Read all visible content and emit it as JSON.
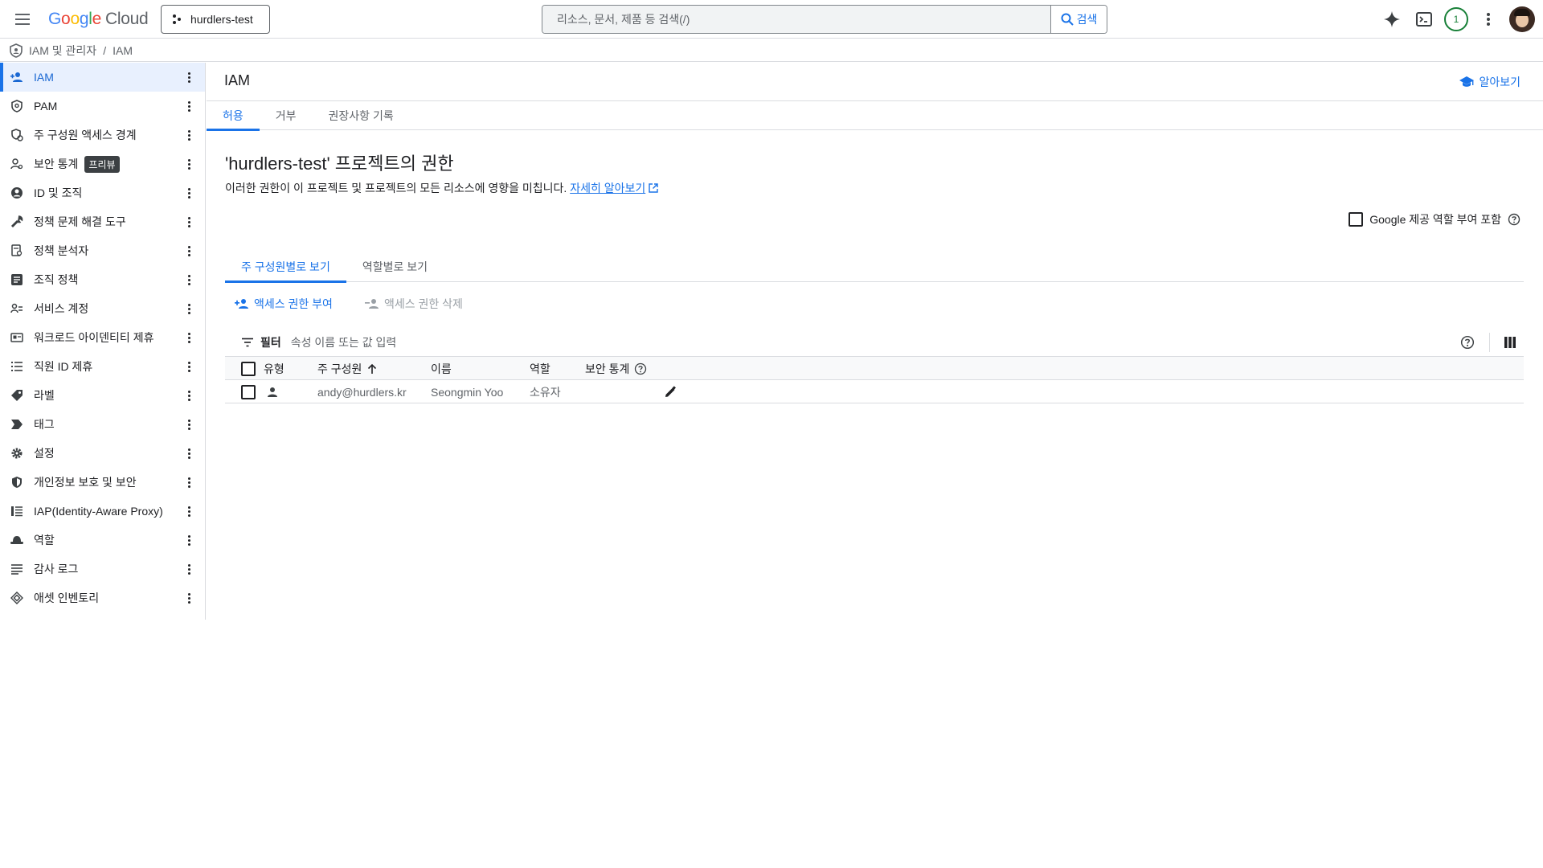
{
  "header": {
    "logo_google": "Google",
    "logo_cloud": "Cloud",
    "project": "hurdlers-test",
    "search_placeholder": "리소스, 문서, 제품 등 검색(/)",
    "search_button": "검색",
    "notifications": "1"
  },
  "breadcrumb": {
    "parent": "IAM 및 관리자",
    "separator": "/",
    "current": "IAM"
  },
  "sidebar": {
    "items": [
      {
        "label": "IAM",
        "icon": "person-add-icon"
      },
      {
        "label": "PAM",
        "icon": "shield-icon"
      },
      {
        "label": "주 구성원 액세스 경계",
        "icon": "boundary-icon"
      },
      {
        "label": "보안 통계",
        "icon": "security-insights-icon",
        "badge": "프리뷰"
      },
      {
        "label": "ID 및 조직",
        "icon": "account-circle-icon"
      },
      {
        "label": "정책 문제 해결 도구",
        "icon": "wrench-icon"
      },
      {
        "label": "정책 분석자",
        "icon": "policy-analyzer-icon"
      },
      {
        "label": "조직 정책",
        "icon": "document-icon"
      },
      {
        "label": "서비스 계정",
        "icon": "service-account-icon"
      },
      {
        "label": "워크로드 아이덴티티 제휴",
        "icon": "id-card-icon"
      },
      {
        "label": "직원 ID 제휴",
        "icon": "list-icon"
      },
      {
        "label": "라벨",
        "icon": "label-icon"
      },
      {
        "label": "태그",
        "icon": "tag-icon"
      },
      {
        "label": "설정",
        "icon": "gear-icon"
      },
      {
        "label": "개인정보 보호 및 보안",
        "icon": "privacy-shield-icon"
      },
      {
        "label": "IAP(Identity-Aware Proxy)",
        "icon": "iap-icon"
      },
      {
        "label": "역할",
        "icon": "hat-icon"
      },
      {
        "label": "감사 로그",
        "icon": "lines-icon"
      },
      {
        "label": "애셋 인벤토리",
        "icon": "diamond-icon"
      }
    ]
  },
  "main": {
    "title": "IAM",
    "learn": "알아보기",
    "tabs": [
      {
        "label": "허용"
      },
      {
        "label": "거부"
      },
      {
        "label": "권장사항 기록"
      }
    ],
    "heading": "'hurdlers-test' 프로젝트의 권한",
    "description": "이러한 권한이 이 프로젝트 및 프로젝트의 모든 리소스에 영향을 미칩니다.",
    "description_link": "자세히 알아보기",
    "google_roles_checkbox": "Google 제공 역할 부여 포함",
    "view_tabs": [
      {
        "label": "주 구성원별로 보기"
      },
      {
        "label": "역할별로 보기"
      }
    ],
    "grant_access": "액세스 권한 부여",
    "remove_access": "액세스 권한 삭제",
    "filter_label": "필터",
    "filter_placeholder": "속성 이름 또는 값 입력",
    "table": {
      "headers": {
        "type": "유형",
        "principal": "주 구성원",
        "name": "이름",
        "role": "역할",
        "insights": "보안 통계"
      },
      "rows": [
        {
          "principal": "andy@hurdlers.kr",
          "name": "Seongmin Yoo",
          "role": "소유자"
        }
      ]
    }
  },
  "colors": {
    "accent": "#1a73e8",
    "active_bg": "#e8f0fe",
    "border": "#dadce0",
    "notif": "#188038"
  }
}
